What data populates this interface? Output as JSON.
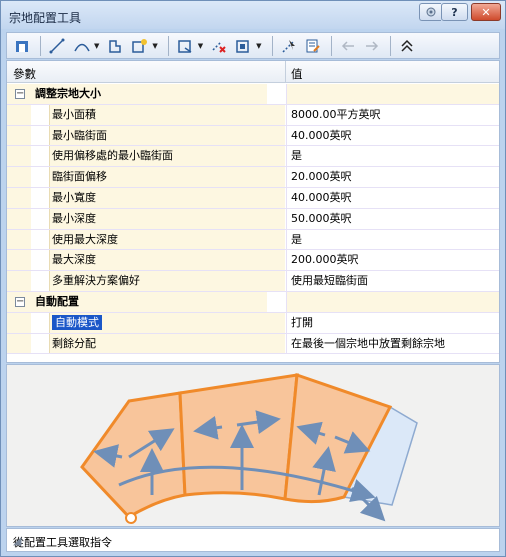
{
  "window": {
    "title": "宗地配置工具"
  },
  "titlebar_buttons": {
    "help": "?",
    "close": "✕"
  },
  "toolbar": {
    "icons": [
      "select-alignment-icon",
      "line-icon",
      "curve-icon",
      "frontage-icon",
      "add-parcel-icon",
      "slide-line-icon",
      "delete-sub-entity-icon",
      "parcel-union-icon",
      "select-line-icon",
      "edit-table-icon",
      "undo-icon",
      "redo-icon",
      "collapse-icon"
    ]
  },
  "grid": {
    "headers": {
      "param": "參數",
      "value": "值"
    },
    "categories": [
      {
        "label": "調整宗地大小",
        "toggle": "−",
        "rows": [
          {
            "name": "最小面積",
            "value": "8000.00平方英呎"
          },
          {
            "name": "最小臨街面",
            "value": "40.000英呎"
          },
          {
            "name": "使用偏移處的最小臨街面",
            "value": "是"
          },
          {
            "name": "臨街面偏移",
            "value": "20.000英呎"
          },
          {
            "name": "最小寬度",
            "value": "40.000英呎"
          },
          {
            "name": "最小深度",
            "value": "50.000英呎"
          },
          {
            "name": "使用最大深度",
            "value": "是"
          },
          {
            "name": "最大深度",
            "value": "200.000英呎"
          },
          {
            "name": "多重解決方案偏好",
            "value": "使用最短臨街面"
          }
        ]
      },
      {
        "label": "自動配置",
        "toggle": "−",
        "rows": [
          {
            "name": "自動模式",
            "value": "打開",
            "selected": true
          },
          {
            "name": "剩餘分配",
            "value": "在最後一個宗地中放置剩餘宗地"
          }
        ]
      }
    ]
  },
  "status": {
    "text": "從配置工具選取指令"
  },
  "colors": {
    "parcel_fill": "#f8c59b",
    "parcel_stroke": "#f08a2a",
    "arrow": "#6f8fb8",
    "remnant_fill": "#dbe8f8"
  }
}
